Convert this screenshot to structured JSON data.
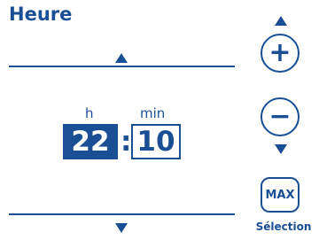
{
  "header": {
    "title": "Heure"
  },
  "time": {
    "hour_label": "h",
    "minute_label": "min",
    "hour_value": "22",
    "separator": ":",
    "minute_value": "10"
  },
  "side_buttons": {
    "plus_symbol": "+",
    "minus_symbol": "−",
    "max_label": "MAX",
    "selection_label": "Sélection"
  },
  "colors": {
    "accent": "#1b4f95",
    "background": "#ffffff"
  },
  "icons": [
    "triangle-up-icon",
    "triangle-down-icon",
    "plus-icon",
    "minus-icon"
  ]
}
